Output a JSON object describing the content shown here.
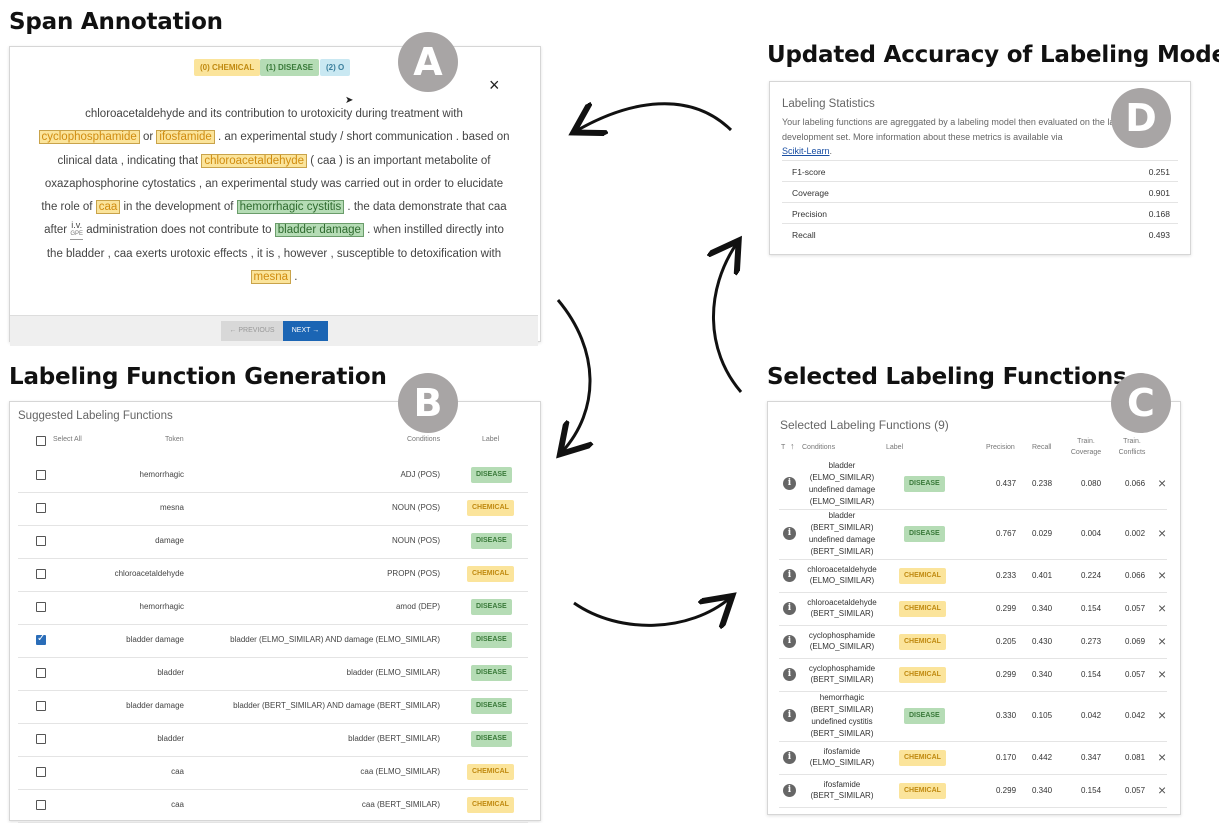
{
  "sections": {
    "a_title": "Span Annotation",
    "b_title": "Labeling Function Generation",
    "c_title": "Selected Labeling Functions",
    "d_title": "Updated Accuracy of Labeling Model",
    "markers": [
      "A",
      "B",
      "C",
      "D"
    ]
  },
  "annotation": {
    "legend": [
      "(0) CHEMICAL",
      "(1) DISEASE",
      "(2) O"
    ],
    "close": "×",
    "text": {
      "l1": "chloroacetaldehyde and its contribution to urotoxicity during treatment with",
      "s_cyclo": "cyclophosphamide",
      "t_or": " or ",
      "s_ifos": "ifosfamide",
      "t2": " . an experimental study / short communication . based on",
      "t3": "clinical data , indicating that ",
      "s_chloro": "chloroacetaldehyde",
      "t4": " ( caa ) is an important metabolite of",
      "l5": "oxazaphosphorine cytostatics , an experimental study was carried out in order to elucidate",
      "t6": "the role of ",
      "s_caa": "caa",
      "t7": " in the development of ",
      "s_hemo": "hemorrhagic cystitis",
      "t8": " . the data demonstrate that caa",
      "t9": "after ",
      "iv": "i.v.",
      "iv_tag": "GPE",
      "t10": " administration does not contribute to ",
      "s_bladder": "bladder damage",
      "t11": " . when instilled directly into",
      "l12": "the bladder , caa exerts urotoxic effects , it is , however , susceptible to detoxification with",
      "s_mesna": "mesna",
      "t13": " ."
    },
    "prev_label": "← PREVIOUS",
    "next_label": "NEXT →"
  },
  "suggested": {
    "title": "Suggested Labeling Functions",
    "headers": {
      "select_all": "Select All",
      "token": "Token",
      "conditions": "Conditions",
      "label": "Label"
    },
    "rows": [
      {
        "token": "hemorrhagic",
        "conditions": "ADJ (POS)",
        "label": "DISEASE",
        "checked": false
      },
      {
        "token": "mesna",
        "conditions": "NOUN (POS)",
        "label": "CHEMICAL",
        "checked": false
      },
      {
        "token": "damage",
        "conditions": "NOUN (POS)",
        "label": "DISEASE",
        "checked": false
      },
      {
        "token": "chloroacetaldehyde",
        "conditions": "PROPN (POS)",
        "label": "CHEMICAL",
        "checked": false
      },
      {
        "token": "hemorrhagic",
        "conditions": "amod (DEP)",
        "label": "DISEASE",
        "checked": false
      },
      {
        "token": "bladder damage",
        "conditions": "bladder (ELMO_SIMILAR) AND damage (ELMO_SIMILAR)",
        "label": "DISEASE",
        "checked": true
      },
      {
        "token": "bladder",
        "conditions": "bladder (ELMO_SIMILAR)",
        "label": "DISEASE",
        "checked": false
      },
      {
        "token": "bladder damage",
        "conditions": "bladder (BERT_SIMILAR) AND damage (BERT_SIMILAR)",
        "label": "DISEASE",
        "checked": false
      },
      {
        "token": "bladder",
        "conditions": "bladder (BERT_SIMILAR)",
        "label": "DISEASE",
        "checked": false
      },
      {
        "token": "caa",
        "conditions": "caa (ELMO_SIMILAR)",
        "label": "CHEMICAL",
        "checked": false
      },
      {
        "token": "caa",
        "conditions": "caa (BERT_SIMILAR)",
        "label": "CHEMICAL",
        "checked": false
      }
    ]
  },
  "selected": {
    "title": "Selected Labeling Functions (9)",
    "headers": {
      "t": "T",
      "sort": "↑",
      "conditions": "Conditions",
      "label": "Label",
      "precision": "Precision",
      "recall": "Recall",
      "coverage": "Train. Coverage",
      "conflicts": "Train. Conflicts"
    },
    "rows": [
      {
        "lines": [
          "bladder",
          "(ELMO_SIMILAR)",
          "undefined damage",
          "(ELMO_SIMILAR)"
        ],
        "label": "DISEASE",
        "precision": "0.437",
        "recall": "0.238",
        "coverage": "0.080",
        "conflicts": "0.066"
      },
      {
        "lines": [
          "bladder",
          "(BERT_SIMILAR)",
          "undefined damage",
          "(BERT_SIMILAR)"
        ],
        "label": "DISEASE",
        "precision": "0.767",
        "recall": "0.029",
        "coverage": "0.004",
        "conflicts": "0.002"
      },
      {
        "lines": [
          "chloroacetaldehyde",
          "(ELMO_SIMILAR)"
        ],
        "label": "CHEMICAL",
        "precision": "0.233",
        "recall": "0.401",
        "coverage": "0.224",
        "conflicts": "0.066"
      },
      {
        "lines": [
          "chloroacetaldehyde",
          "(BERT_SIMILAR)"
        ],
        "label": "CHEMICAL",
        "precision": "0.299",
        "recall": "0.340",
        "coverage": "0.154",
        "conflicts": "0.057"
      },
      {
        "lines": [
          "cyclophosphamide",
          "(ELMO_SIMILAR)"
        ],
        "label": "CHEMICAL",
        "precision": "0.205",
        "recall": "0.430",
        "coverage": "0.273",
        "conflicts": "0.069"
      },
      {
        "lines": [
          "cyclophosphamide",
          "(BERT_SIMILAR)"
        ],
        "label": "CHEMICAL",
        "precision": "0.299",
        "recall": "0.340",
        "coverage": "0.154",
        "conflicts": "0.057"
      },
      {
        "lines": [
          "hemorrhagic",
          "(BERT_SIMILAR)",
          "undefined cystitis",
          "(BERT_SIMILAR)"
        ],
        "label": "DISEASE",
        "precision": "0.330",
        "recall": "0.105",
        "coverage": "0.042",
        "conflicts": "0.042"
      },
      {
        "lines": [
          "ifosfamide",
          "(ELMO_SIMILAR)"
        ],
        "label": "CHEMICAL",
        "precision": "0.170",
        "recall": "0.442",
        "coverage": "0.347",
        "conflicts": "0.081"
      },
      {
        "lines": [
          "ifosfamide",
          "(BERT_SIMILAR)"
        ],
        "label": "CHEMICAL",
        "precision": "0.299",
        "recall": "0.340",
        "coverage": "0.154",
        "conflicts": "0.057"
      }
    ],
    "remove": "×",
    "info": "i"
  },
  "stats": {
    "title": "Labeling Statistics",
    "desc": "Your labeling functions are agreggated by a labeling model then evaluated on the labeled development set. More information about these metrics is available via",
    "link": "Scikit-Learn",
    "link_tail": ".",
    "rows": [
      {
        "k": "F1-score",
        "v": "0.251"
      },
      {
        "k": "Coverage",
        "v": "0.901"
      },
      {
        "k": "Precision",
        "v": "0.168"
      },
      {
        "k": "Recall",
        "v": "0.493"
      }
    ]
  },
  "colors": {
    "chemical": "#fbe49b",
    "disease": "#b5dcb5",
    "other": "#c9e8f2",
    "accent": "#1b65b4",
    "marker": "#a8a5a5"
  }
}
